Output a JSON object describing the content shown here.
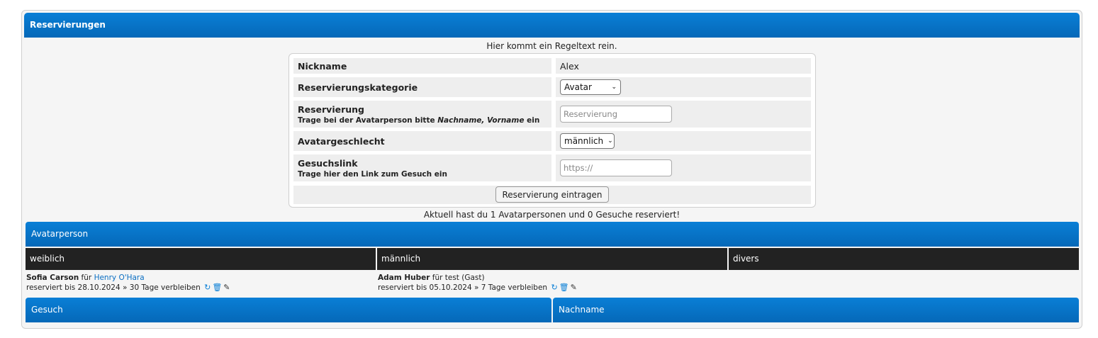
{
  "header": {
    "title": "Reservierungen"
  },
  "rules_text": "Hier kommt ein Regeltext rein.",
  "form": {
    "nickname_label": "Nickname",
    "nickname_value": "Alex",
    "category_label": "Reservierungskategorie",
    "category_value": "Avatar",
    "reservation_label": "Reservierung",
    "reservation_hint_prefix": "Trage bei der Avatarperson bitte ",
    "reservation_hint_italic": "Nachname, Vorname",
    "reservation_hint_suffix": " ein",
    "reservation_placeholder": "Reservierung",
    "gender_label": "Avatargeschlecht",
    "gender_value": "männlich",
    "link_label": "Gesuchslink",
    "link_hint": "Trage hier den Link zum Gesuch ein",
    "link_placeholder": "https://",
    "submit_label": "Reservierung eintragen"
  },
  "status_text": "Aktuell hast du 1 Avatarpersonen und 0 Gesuche reserviert!",
  "avatar_section": {
    "title": "Avatarperson",
    "columns": [
      "weiblich",
      "männlich",
      "divers"
    ],
    "entries": [
      {
        "name": "Sofia Carson",
        "for_text": " für ",
        "user": "Henry O'Hara",
        "user_suffix": "",
        "reserved_line": "reserviert bis 28.10.2024 » 30 Tage verbleiben"
      },
      {
        "name": "Adam Huber",
        "for_text": " für ",
        "user": "",
        "user_suffix": "test (Gast)",
        "reserved_line": "reserviert bis 05.10.2024 » 7 Tage verbleiben"
      }
    ]
  },
  "gesuch_section": {
    "col1": "Gesuch",
    "col2": "Nachname"
  },
  "icons": [
    "refresh-icon",
    "trash-icon",
    "edit-icon"
  ],
  "colors": {
    "accent": "#0a7fd6",
    "dark": "#222222",
    "link": "#0a6ec2"
  }
}
